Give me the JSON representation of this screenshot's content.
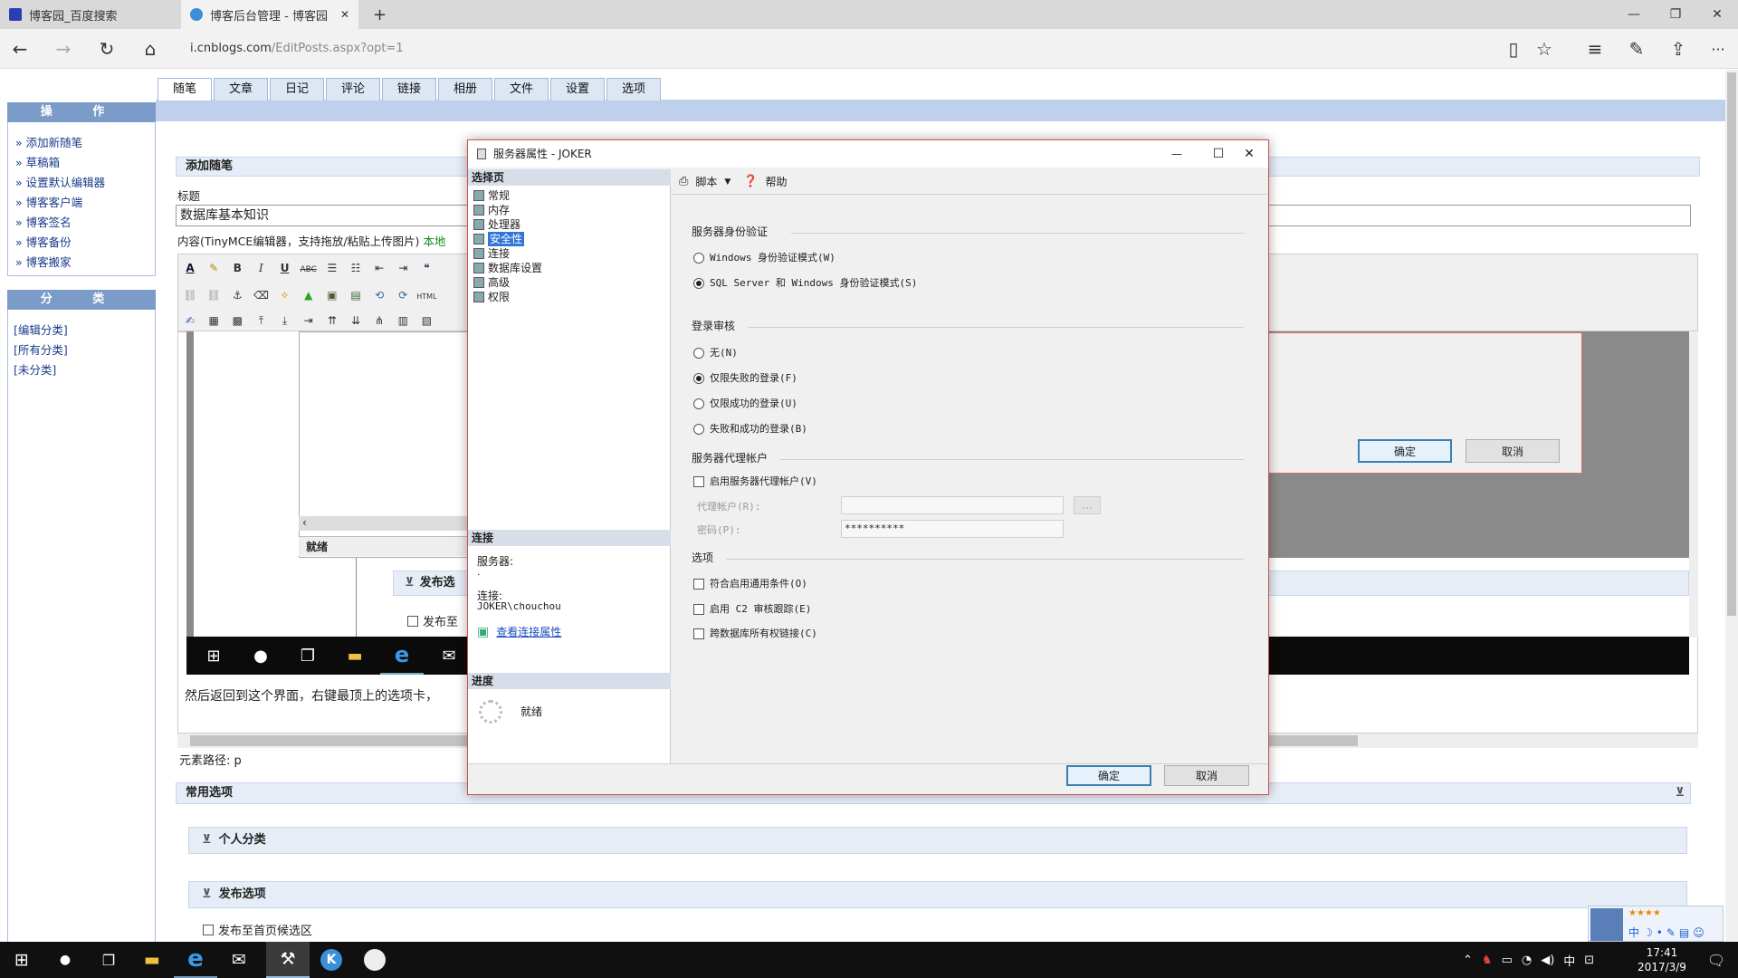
{
  "browser": {
    "tabs": [
      {
        "label": "博客园_百度搜索",
        "active": false
      },
      {
        "label": "博客后台管理 - 博客园",
        "active": true
      }
    ],
    "new_tab": "+",
    "url_host": "i.cnblogs.com",
    "url_path": "/EditPosts.aspx?opt=1",
    "nav": {
      "back": "←",
      "forward": "→",
      "refresh": "↻",
      "home": "⌂"
    },
    "window": {
      "minimize": "—",
      "restore": "❐",
      "close": "✕"
    },
    "toolbar_icons": {
      "reading": "▯",
      "favorite": "☆",
      "hub": "≡",
      "note": "✎",
      "share": "⇪",
      "more": "···"
    }
  },
  "sidebar": {
    "ops_title": "操 作",
    "ops_items": [
      "» 添加新随笔",
      "» 草稿箱",
      "» 设置默认编辑器",
      "» 博客客户端",
      "» 博客签名",
      "» 博客备份",
      "» 博客搬家"
    ],
    "cat_title": "分 类",
    "cat_items": [
      "[编辑分类]",
      "[所有分类]",
      "[未分类]"
    ]
  },
  "main_tabs": [
    "随笔",
    "文章",
    "日记",
    "评论",
    "链接",
    "相册",
    "文件",
    "设置",
    "选项"
  ],
  "editor": {
    "section_title": "添加随笔",
    "title_label": "标题",
    "title_value": "数据库基本知识",
    "content_label": "内容(TinyMCE编辑器，支持拖放/粘贴上传图片)",
    "content_link": "本地",
    "status_ready": "就绪",
    "publish_partial": "发布选",
    "publish_to_partial": "发布至",
    "body_text": "然后返回到这个界面，右键最顶上的选项卡，",
    "element_path": "元素路径: p",
    "common_options": "常用选项",
    "personal_category": "个人分类",
    "publish_options": "发布选项",
    "publish_homepage": "发布至首页候选区",
    "scroll_left": "‹"
  },
  "bg_dialog": {
    "ok": "确定",
    "cancel": "取消"
  },
  "dialog": {
    "title": "服务器属性 - JOKER",
    "controls": {
      "minimize": "—",
      "maximize": "☐",
      "close": "✕"
    },
    "select_page": "选择页",
    "pages": [
      "常规",
      "内存",
      "处理器",
      "安全性",
      "连接",
      "数据库设置",
      "高级",
      "权限"
    ],
    "selected_page": "安全性",
    "connection_head": "连接",
    "server_label": "服务器:",
    "server_value": ".",
    "conn_label": "连接:",
    "conn_value": "JOKER\\chouchou",
    "view_conn": "查看连接属性",
    "progress_head": "进度",
    "progress_status": "就绪",
    "toolbar": {
      "script": "脚本",
      "help": "帮助"
    },
    "auth_group": "服务器身份验证",
    "auth_options": [
      {
        "label": "Windows 身份验证模式(W)",
        "checked": false
      },
      {
        "label": "SQL Server 和 Windows 身份验证模式(S)",
        "checked": true
      }
    ],
    "audit_group": "登录审核",
    "audit_options": [
      {
        "label": "无(N)",
        "checked": false
      },
      {
        "label": "仅限失败的登录(F)",
        "checked": true
      },
      {
        "label": "仅限成功的登录(U)",
        "checked": false
      },
      {
        "label": "失败和成功的登录(B)",
        "checked": false
      }
    ],
    "proxy_group": "服务器代理帐户",
    "proxy_enable": "启用服务器代理帐户(V)",
    "proxy_account_label": "代理帐户(R):",
    "proxy_password_label": "密码(P):",
    "proxy_password_value": "**********",
    "proxy_browse": "...",
    "options_group": "选项",
    "options": [
      "符合启用通用条件(O)",
      "启用 C2 审核跟踪(E)",
      "跨数据库所有权链接(C)"
    ],
    "ok": "确定",
    "cancel": "取消"
  },
  "taskbar": {
    "time": "17:41",
    "date": "2017/3/9",
    "ime": "中",
    "notif": "🗨"
  },
  "colors": {
    "accent": "#3376d6",
    "sidebar_head": "#7b9bc9",
    "dialog_border": "#d05050"
  }
}
